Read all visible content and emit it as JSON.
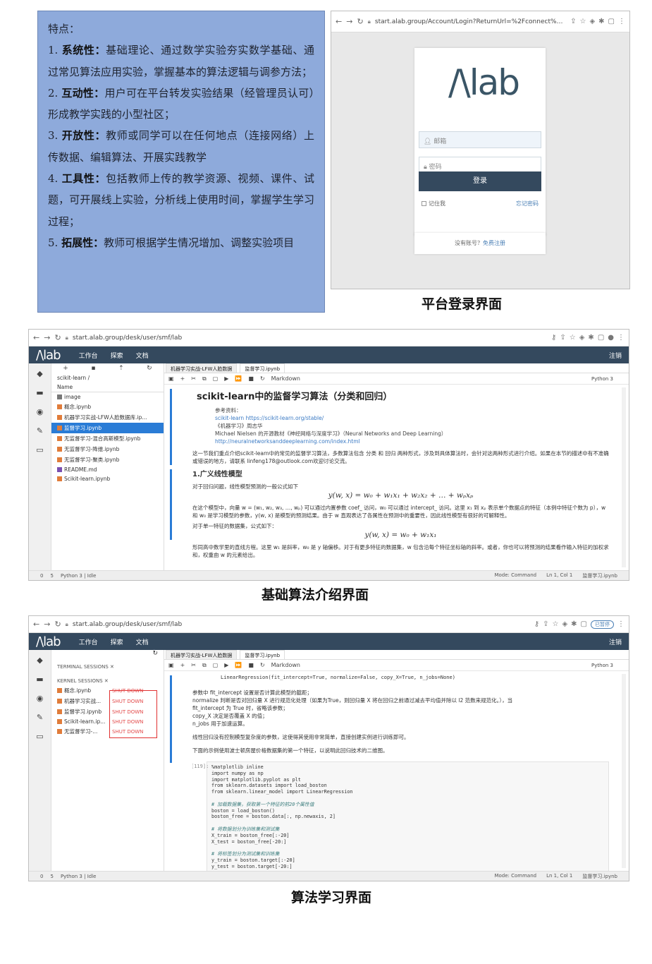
{
  "features": {
    "heading": "特点：",
    "items": [
      {
        "num": "1.",
        "title": "系统性：",
        "text": "基础理论、通过数学实验夯实数学基础、通过常见算法应用实验，掌握基本的算法逻辑与调参方法；"
      },
      {
        "num": "2.",
        "title": "互动性：",
        "text": "用户可在平台转发实验结果（经管理员认可）形成教学实践的小型社区；"
      },
      {
        "num": "3.",
        "title": "开放性：",
        "text": "教师或同学可以在任何地点（连接网络）上传数据、编辑算法、开展实践教学"
      },
      {
        "num": "4.",
        "title": "工具性：",
        "text": "包括教师上传的教学资源、视频、课件、试题，可开展线上实验，分析线上使用时间，掌握学生学习过程；"
      },
      {
        "num": "5.",
        "title": "拓展性：",
        "text": "教师可根据学生情况增加、调整实验项目"
      }
    ]
  },
  "login": {
    "url": "start.alab.group/Account/Login?ReturnUrl=%2Fconnect%2Fauthorize%2Fcal...",
    "logo": "/\\lab",
    "email_placeholder": "邮箱",
    "password_placeholder": "密码",
    "login_button": "登录",
    "remember": "记住我",
    "forgot": "忘记密码",
    "no_account": "没有账号？",
    "register": "免费注册",
    "caption": "平台登录界面"
  },
  "intro": {
    "url": "start.alab.group/desk/user/smf/lab",
    "logo": "/\\lab",
    "nav": [
      "工作台",
      "探索",
      "文档"
    ],
    "logout": "注销",
    "breadcrumb": "scikit-learn /",
    "col_name": "Name",
    "files": [
      "image",
      "概念.ipynb",
      "机器学习实战-LFW人脸数据库.ip...",
      "监督学习.ipynb",
      "无监督学习-混合高斯模型.ipynb",
      "无监督学习-降维.ipynb",
      "无监督学习-聚类.ipynb",
      "README.md",
      "Scikit-learn.ipynb"
    ],
    "tabs": [
      "机器学习实战-LFW人脸数据",
      "监督学习.ipynb"
    ],
    "kernel_select": "Markdown",
    "kernel": "Python 3",
    "title_prefix": "scikit-learn",
    "title_rest": "中的监督学习算法（分类和回归）",
    "refs": [
      "参考资料：",
      "scikit-learn https://scikit-learn.org/stable/",
      "《机器学习》周志华",
      "Michael Nielsen 的开源教材《神经网络与深度学习》（Neural Networks and Deep Learning）",
      "http://neuralnetworksanddeeplearning.com/index.html"
    ],
    "para1": "这一节我们重点介绍scikit-learn中的常见的监督学习算法，多数算法包含 分类 和 回归 两种形式，涉及到具体算法时，会针对这两种形式进行介绍。如果在本节的描述中有不准确或错误的地方，请联系 linfeng178@outlook.com欢迎讨论交流。",
    "h1": "1.广义线性模型",
    "para2": "对于回归问题，线性模型预测的一般公式如下",
    "formula1": "y(w, x) = w₀ + w₁x₁ + w₂x₂ + … + wₚxₚ",
    "para3": "在这个模型中，向量 w = (w₁, w₂, w₃, …, wₚ) 可以通过内置参数 coef_ 访问，w₀ 可以通过 intercept_ 访问。这里 x₁ 到 xₚ 表示单个数据点的特征（本例中特征个数为 p），w 和 w₀ 是学习模型的参数，y(w, x) 是模型的预测结果。由于 w 直观表达了各属性在预测中的重要性，因此线性模型有很好的可解释性。",
    "para4": "对于单一特征的数据集，公式如下：",
    "formula2": "y(w, x) = w₀ + w₁x₁",
    "para5": "形同高中数学里的直线方程。这里 w₁ 是斜率，w₀ 是 y 轴偏移。对于有更多特征的数据集，w 包含沿每个特征坐标轴的斜率。或者，你也可以将预测的结果看作输入特征的加权求和，权重由 w 的元素给出。",
    "status_left": [
      "0",
      "5",
      "Python 3 | Idle"
    ],
    "status_right": [
      "Mode: Command",
      "Ln 1, Col 1",
      "监督学习.ipynb"
    ],
    "caption": "基础算法介绍界面"
  },
  "study": {
    "url": "start.alab.group/desk/user/smf/lab",
    "paused": "已暂停",
    "terminal_sessions": "TERMINAL SESSIONS",
    "kernel_sessions": "KERNEL SESSIONS",
    "kernels": [
      "概念.ipynb",
      "机器学习实战...",
      "监督学习.ipynb",
      "Scikit-learn.ip...",
      "无监督学习-..."
    ],
    "shutdown": "SHUT DOWN",
    "code_top": "LinearRegression(fit_intercept=True, normalize=False, copy_X=True, n_jobs=None)",
    "params_intro": "参数中 fit_intercept 设置是否计算此模型的截距；",
    "params": [
      "normalize 判断是否对回归量 X 进行规范化处理（如果为True，则回归量 X 将在回归之前通过减去平均值并除以 l2 范数来规范化。），当",
      "fit_intercept 为 True 时，省略该参数；",
      "copy_X 决定是否覆盖 X 的值；",
      "n_jobs 用于加速运算。"
    ],
    "para1": "线性回归没有控制模型复杂度的参数，这使得其使用非常简单，直接创建实例进行训练即可。",
    "para2": "下面的示例使用波士顿房屋价格数据集的第一个特征，以说明此回归技术的二维图。",
    "prompt": "[119]:",
    "code": [
      "%matplotlib inline",
      "import numpy as np",
      "import matplotlib.pyplot as plt",
      "from sklearn.datasets import load_boston",
      "from sklearn.linear_model import LinearRegression",
      "",
      "# 加载数据集，获取第一个特征的前20个属性值",
      "boston = load_boston()",
      "boston_free = boston.data[:, np.newaxis, 2]",
      "",
      "# 将数据划分为训练集和测试集",
      "X_train = boston_free[:-20]",
      "X_test = boston_free[-20:]",
      "",
      "# 将标签划分为测试集和训练集",
      "y_train = boston.target[:-20]",
      "y_test = boston.target[-20:]"
    ],
    "caption": "算法学习界面"
  }
}
